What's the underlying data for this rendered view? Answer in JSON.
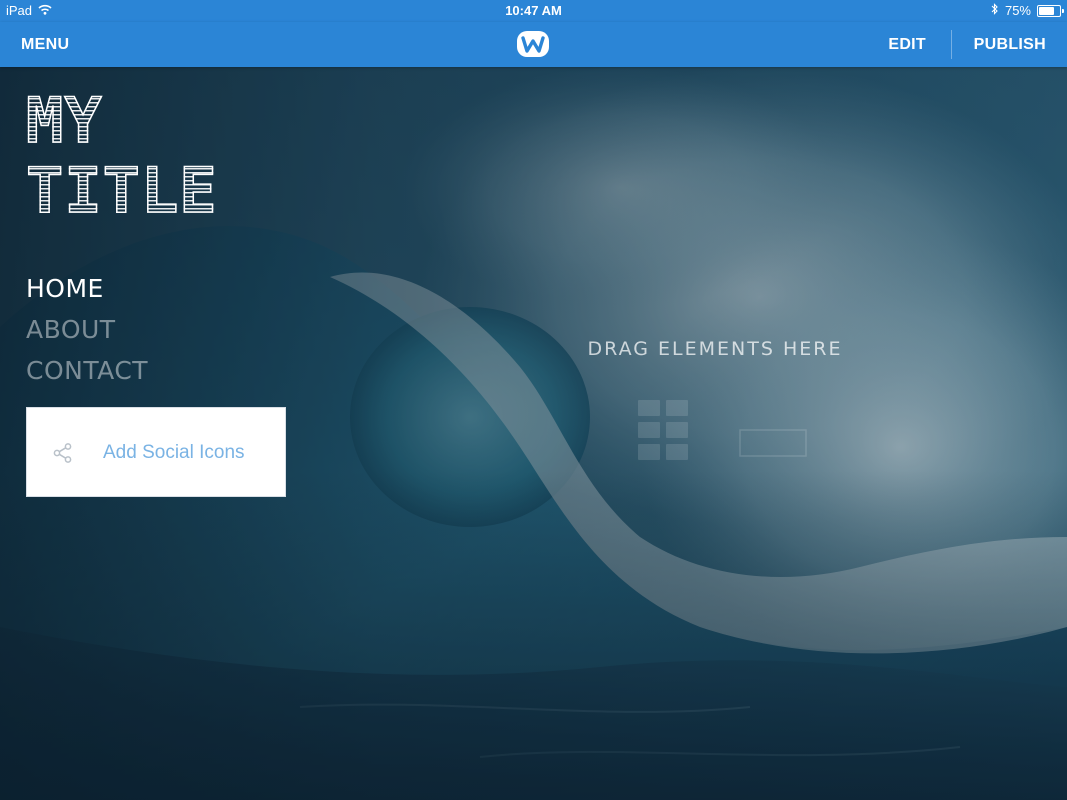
{
  "status_bar": {
    "device": "iPad",
    "time": "10:47 AM",
    "battery": "75%",
    "battery_level": 0.75,
    "icons": [
      "wifi-icon",
      "bluetooth-icon",
      "battery-icon"
    ]
  },
  "toolbar": {
    "menu_label": "MENU",
    "logo": "weebly-logo-icon",
    "edit_label": "EDIT",
    "publish_label": "PUBLISH"
  },
  "site": {
    "title_line1": "MY",
    "title_line2": "TITLE",
    "nav": [
      {
        "label": "HOME",
        "active": true
      },
      {
        "label": "ABOUT",
        "active": false
      },
      {
        "label": "CONTACT",
        "active": false
      }
    ],
    "social": {
      "icon": "share-icon",
      "label": "Add Social Icons"
    },
    "drop_zone_text": "DRAG ELEMENTS HERE",
    "background": "ocean-wave-image"
  },
  "colors": {
    "toolbar": "#2b85d6",
    "social_label": "#7ab3e4"
  }
}
